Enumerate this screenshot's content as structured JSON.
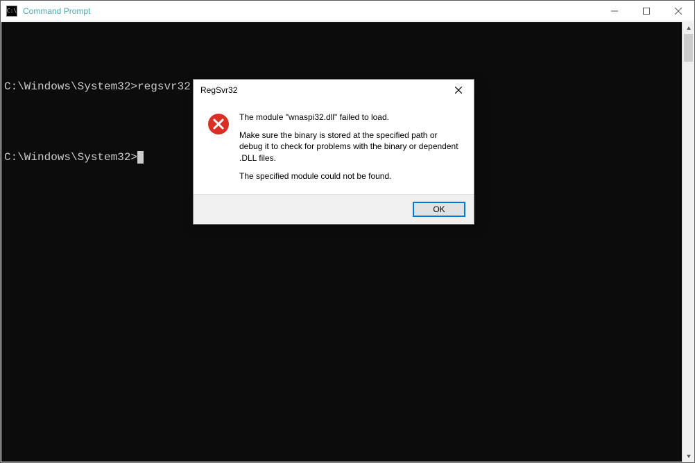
{
  "cmd": {
    "title": "Command Prompt",
    "line1_prompt": "C:\\Windows\\System32>",
    "line1_cmd": "regsvr32 wnaspi32.dll",
    "line2_prompt": "C:\\Windows\\System32>"
  },
  "dlg": {
    "title": "RegSvr32",
    "p1": "The module \"wnaspi32.dll\" failed to load.",
    "p2": "Make sure the binary is stored at the specified path or debug it to check for problems with the binary or dependent .DLL files.",
    "p3": "The specified module could not be found.",
    "ok": "OK"
  }
}
